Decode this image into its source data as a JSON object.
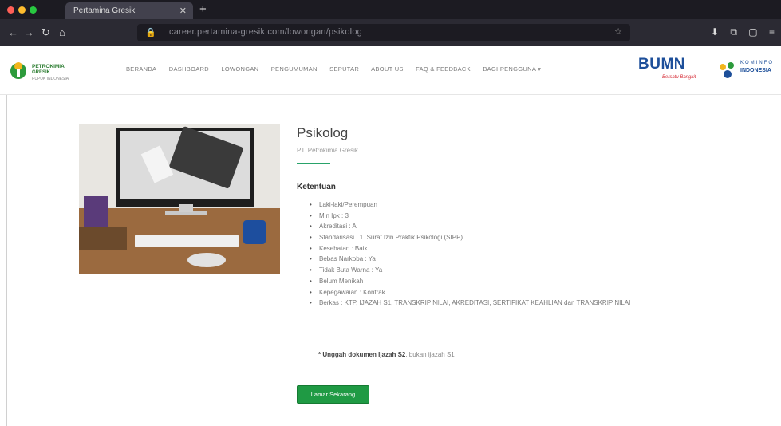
{
  "browser": {
    "tab_title": "Pertamina Gresik",
    "url": "career.pertamina-gresik.com/lowongan/psikolog",
    "traffic_colors": [
      "#ff5f57",
      "#febc2e",
      "#28c840"
    ]
  },
  "site": {
    "logo": {
      "line1": "PETROKIMIA",
      "line2": "GRESIK",
      "line3": "PUPUK INDONESIA"
    },
    "nav": [
      "BERANDA",
      "DASHBOARD",
      "LOWONGAN",
      "PENGUMUMAN",
      "SEPUTAR",
      "ABOUT US",
      "FAQ & FEEDBACK",
      "BAGI PENGGUNA ▾"
    ],
    "partner1": {
      "name": "BUMN",
      "tagline": "Bersatu Bangkit"
    },
    "partner2": {
      "line1": "KOMINFO",
      "line2": "INDONESIA"
    }
  },
  "job": {
    "title": "Psikolog",
    "company": "PT. Petrokimia Gresik",
    "requirements_heading": "Ketentuan",
    "requirements": [
      "Laki-laki/Perempuan",
      "Min Ipk : 3",
      "Akreditasi : A",
      "Standarisasi : 1. Surat Izin Praktik Psikologi (SIPP)",
      "Kesehatan : Baik",
      "Bebas Narkoba : Ya",
      "Tidak Buta Warna : Ya",
      "Belum Menikah",
      "Kepegawaian : Kontrak",
      "Berkas : KTP, IJAZAH S1, TRANSKRIP NILAI, AKREDITASI, SERTIFIKAT KEAHLIAN dan TRANSKRIP NILAI"
    ],
    "note_bold": "* Unggah dokumen Ijazah S2",
    "note_rest": ", bukan ijazah S1",
    "apply_button": "Lamar Sekarang"
  },
  "colors": {
    "accent": "#1f9a44",
    "divider": "#29a36a",
    "tab_bar": "#1c1b22",
    "toolbar": "#2b2a33"
  },
  "icons": [
    "back-icon",
    "forward-icon",
    "reload-icon",
    "home-icon",
    "lock-icon",
    "download-icon",
    "extensions-icon",
    "menu-icon"
  ]
}
